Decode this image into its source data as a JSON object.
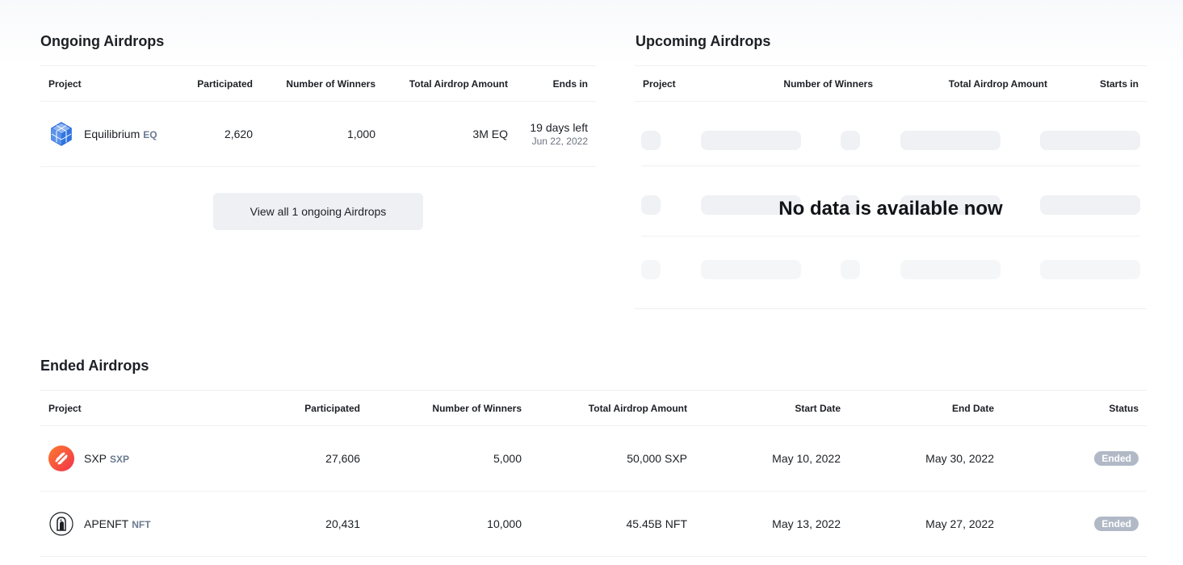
{
  "ongoing": {
    "title": "Ongoing Airdrops",
    "columns": [
      "Project",
      "Participated",
      "Number of Winners",
      "Total Airdrop Amount",
      "Ends in"
    ],
    "rows": [
      {
        "name": "Equilibrium",
        "symbol": "EQ",
        "icon": "equilibrium-cube-icon",
        "participated": "2,620",
        "winners": "1,000",
        "amount": "3M EQ",
        "ends_in": "19 days left",
        "ends_date": "Jun 22, 2022"
      }
    ],
    "view_all_label": "View all 1 ongoing Airdrops"
  },
  "upcoming": {
    "title": "Upcoming Airdrops",
    "columns": [
      "Project",
      "Number of Winners",
      "Total Airdrop Amount",
      "Starts in"
    ],
    "empty_message": "No data is available now"
  },
  "ended": {
    "title": "Ended Airdrops",
    "columns": [
      "Project",
      "Participated",
      "Number of Winners",
      "Total Airdrop Amount",
      "Start Date",
      "End Date",
      "Status"
    ],
    "rows": [
      {
        "name": "SXP",
        "symbol": "SXP",
        "icon": "sxp-logo-icon",
        "participated": "27,606",
        "winners": "5,000",
        "amount": "50,000 SXP",
        "start": "May 10, 2022",
        "end": "May 30, 2022",
        "status": "Ended"
      },
      {
        "name": "APENFT",
        "symbol": "NFT",
        "icon": "apenft-logo-icon",
        "participated": "20,431",
        "winners": "10,000",
        "amount": "45.45B NFT",
        "start": "May 13, 2022",
        "end": "May 27, 2022",
        "status": "Ended"
      }
    ]
  },
  "colors": {
    "status_badge": "#b1b9c6",
    "button_bg": "#eef0f3",
    "symbol_text": "#6b7a90",
    "skeleton": "#eff1f4"
  }
}
